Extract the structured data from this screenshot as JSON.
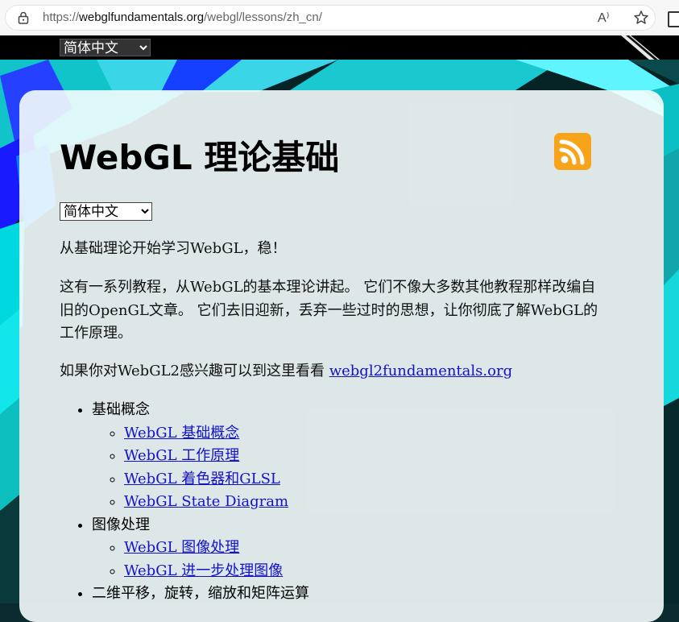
{
  "browser": {
    "url_prefix": "https://",
    "url_host": "webglfundamentals.org",
    "url_path": "/webgl/lessons/zh_cn/",
    "read_aloud_label": "A⁾"
  },
  "language": {
    "selected": "简体中文"
  },
  "page": {
    "title": "WebGL 理论基础",
    "intro": "从基础理论开始学习WebGL，稳！",
    "description": "这有一系列教程，从WebGL的基本理论讲起。 它们不像大多数其他教程那样改编自旧的OpenGL文章。 它们去旧迎新，丢弃一些过时的思想，让你彻底了解WebGL的工作原理。",
    "webgl2_prefix": "如果你对WebGL2感兴趣可以到这里看看 ",
    "webgl2_link": "webgl2fundamentals.org"
  },
  "toc": [
    {
      "label": "基础概念",
      "items": [
        "WebGL 基础概念",
        "WebGL 工作原理",
        "WebGL 着色器和GLSL",
        "WebGL State Diagram"
      ]
    },
    {
      "label": "图像处理",
      "items": [
        "WebGL 图像处理",
        "WebGL 进一步处理图像"
      ]
    },
    {
      "label": "二维平移，旋转，缩放和矩阵运算",
      "items": []
    }
  ],
  "colors": {
    "rss": "#f7a41a",
    "link": "#1212c8"
  }
}
